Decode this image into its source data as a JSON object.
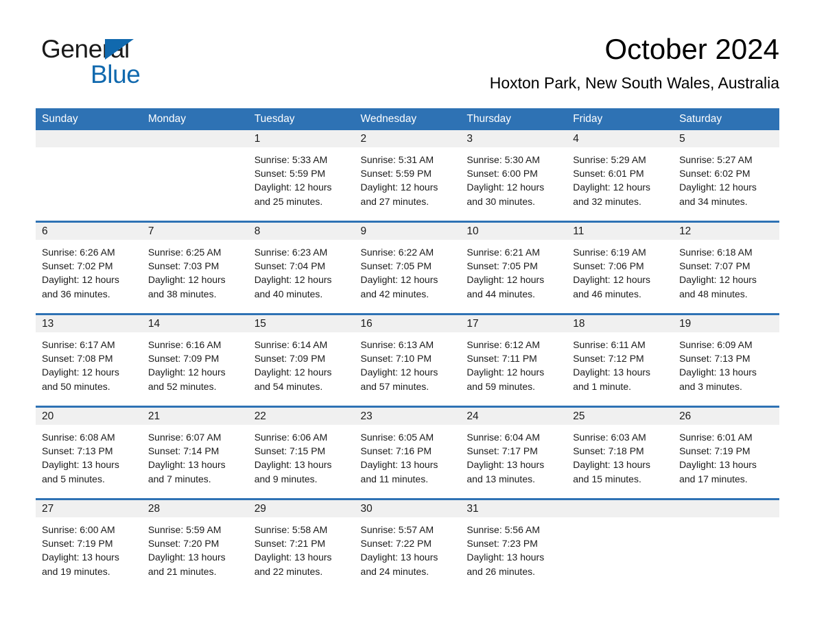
{
  "brand": {
    "name_part1": "General",
    "name_part2": "Blue",
    "accent_color": "#1169ae"
  },
  "header": {
    "month_title": "October 2024",
    "location": "Hoxton Park, New South Wales, Australia"
  },
  "theme": {
    "header_blue": "#2e72b4",
    "daynum_band_gray": "#f0f0f0",
    "text_color": "#1a1a1a",
    "page_background": "#ffffff"
  },
  "calendar": {
    "weekday_headers": [
      "Sunday",
      "Monday",
      "Tuesday",
      "Wednesday",
      "Thursday",
      "Friday",
      "Saturday"
    ],
    "weeks": [
      [
        {
          "day": "",
          "lines": []
        },
        {
          "day": "",
          "lines": []
        },
        {
          "day": "1",
          "lines": [
            "Sunrise: 5:33 AM",
            "Sunset: 5:59 PM",
            "Daylight: 12 hours",
            "and 25 minutes."
          ]
        },
        {
          "day": "2",
          "lines": [
            "Sunrise: 5:31 AM",
            "Sunset: 5:59 PM",
            "Daylight: 12 hours",
            "and 27 minutes."
          ]
        },
        {
          "day": "3",
          "lines": [
            "Sunrise: 5:30 AM",
            "Sunset: 6:00 PM",
            "Daylight: 12 hours",
            "and 30 minutes."
          ]
        },
        {
          "day": "4",
          "lines": [
            "Sunrise: 5:29 AM",
            "Sunset: 6:01 PM",
            "Daylight: 12 hours",
            "and 32 minutes."
          ]
        },
        {
          "day": "5",
          "lines": [
            "Sunrise: 5:27 AM",
            "Sunset: 6:02 PM",
            "Daylight: 12 hours",
            "and 34 minutes."
          ]
        }
      ],
      [
        {
          "day": "6",
          "lines": [
            "Sunrise: 6:26 AM",
            "Sunset: 7:02 PM",
            "Daylight: 12 hours",
            "and 36 minutes."
          ]
        },
        {
          "day": "7",
          "lines": [
            "Sunrise: 6:25 AM",
            "Sunset: 7:03 PM",
            "Daylight: 12 hours",
            "and 38 minutes."
          ]
        },
        {
          "day": "8",
          "lines": [
            "Sunrise: 6:23 AM",
            "Sunset: 7:04 PM",
            "Daylight: 12 hours",
            "and 40 minutes."
          ]
        },
        {
          "day": "9",
          "lines": [
            "Sunrise: 6:22 AM",
            "Sunset: 7:05 PM",
            "Daylight: 12 hours",
            "and 42 minutes."
          ]
        },
        {
          "day": "10",
          "lines": [
            "Sunrise: 6:21 AM",
            "Sunset: 7:05 PM",
            "Daylight: 12 hours",
            "and 44 minutes."
          ]
        },
        {
          "day": "11",
          "lines": [
            "Sunrise: 6:19 AM",
            "Sunset: 7:06 PM",
            "Daylight: 12 hours",
            "and 46 minutes."
          ]
        },
        {
          "day": "12",
          "lines": [
            "Sunrise: 6:18 AM",
            "Sunset: 7:07 PM",
            "Daylight: 12 hours",
            "and 48 minutes."
          ]
        }
      ],
      [
        {
          "day": "13",
          "lines": [
            "Sunrise: 6:17 AM",
            "Sunset: 7:08 PM",
            "Daylight: 12 hours",
            "and 50 minutes."
          ]
        },
        {
          "day": "14",
          "lines": [
            "Sunrise: 6:16 AM",
            "Sunset: 7:09 PM",
            "Daylight: 12 hours",
            "and 52 minutes."
          ]
        },
        {
          "day": "15",
          "lines": [
            "Sunrise: 6:14 AM",
            "Sunset: 7:09 PM",
            "Daylight: 12 hours",
            "and 54 minutes."
          ]
        },
        {
          "day": "16",
          "lines": [
            "Sunrise: 6:13 AM",
            "Sunset: 7:10 PM",
            "Daylight: 12 hours",
            "and 57 minutes."
          ]
        },
        {
          "day": "17",
          "lines": [
            "Sunrise: 6:12 AM",
            "Sunset: 7:11 PM",
            "Daylight: 12 hours",
            "and 59 minutes."
          ]
        },
        {
          "day": "18",
          "lines": [
            "Sunrise: 6:11 AM",
            "Sunset: 7:12 PM",
            "Daylight: 13 hours",
            "and 1 minute."
          ]
        },
        {
          "day": "19",
          "lines": [
            "Sunrise: 6:09 AM",
            "Sunset: 7:13 PM",
            "Daylight: 13 hours",
            "and 3 minutes."
          ]
        }
      ],
      [
        {
          "day": "20",
          "lines": [
            "Sunrise: 6:08 AM",
            "Sunset: 7:13 PM",
            "Daylight: 13 hours",
            "and 5 minutes."
          ]
        },
        {
          "day": "21",
          "lines": [
            "Sunrise: 6:07 AM",
            "Sunset: 7:14 PM",
            "Daylight: 13 hours",
            "and 7 minutes."
          ]
        },
        {
          "day": "22",
          "lines": [
            "Sunrise: 6:06 AM",
            "Sunset: 7:15 PM",
            "Daylight: 13 hours",
            "and 9 minutes."
          ]
        },
        {
          "day": "23",
          "lines": [
            "Sunrise: 6:05 AM",
            "Sunset: 7:16 PM",
            "Daylight: 13 hours",
            "and 11 minutes."
          ]
        },
        {
          "day": "24",
          "lines": [
            "Sunrise: 6:04 AM",
            "Sunset: 7:17 PM",
            "Daylight: 13 hours",
            "and 13 minutes."
          ]
        },
        {
          "day": "25",
          "lines": [
            "Sunrise: 6:03 AM",
            "Sunset: 7:18 PM",
            "Daylight: 13 hours",
            "and 15 minutes."
          ]
        },
        {
          "day": "26",
          "lines": [
            "Sunrise: 6:01 AM",
            "Sunset: 7:19 PM",
            "Daylight: 13 hours",
            "and 17 minutes."
          ]
        }
      ],
      [
        {
          "day": "27",
          "lines": [
            "Sunrise: 6:00 AM",
            "Sunset: 7:19 PM",
            "Daylight: 13 hours",
            "and 19 minutes."
          ]
        },
        {
          "day": "28",
          "lines": [
            "Sunrise: 5:59 AM",
            "Sunset: 7:20 PM",
            "Daylight: 13 hours",
            "and 21 minutes."
          ]
        },
        {
          "day": "29",
          "lines": [
            "Sunrise: 5:58 AM",
            "Sunset: 7:21 PM",
            "Daylight: 13 hours",
            "and 22 minutes."
          ]
        },
        {
          "day": "30",
          "lines": [
            "Sunrise: 5:57 AM",
            "Sunset: 7:22 PM",
            "Daylight: 13 hours",
            "and 24 minutes."
          ]
        },
        {
          "day": "31",
          "lines": [
            "Sunrise: 5:56 AM",
            "Sunset: 7:23 PM",
            "Daylight: 13 hours",
            "and 26 minutes."
          ]
        },
        {
          "day": "",
          "lines": []
        },
        {
          "day": "",
          "lines": []
        }
      ]
    ]
  }
}
